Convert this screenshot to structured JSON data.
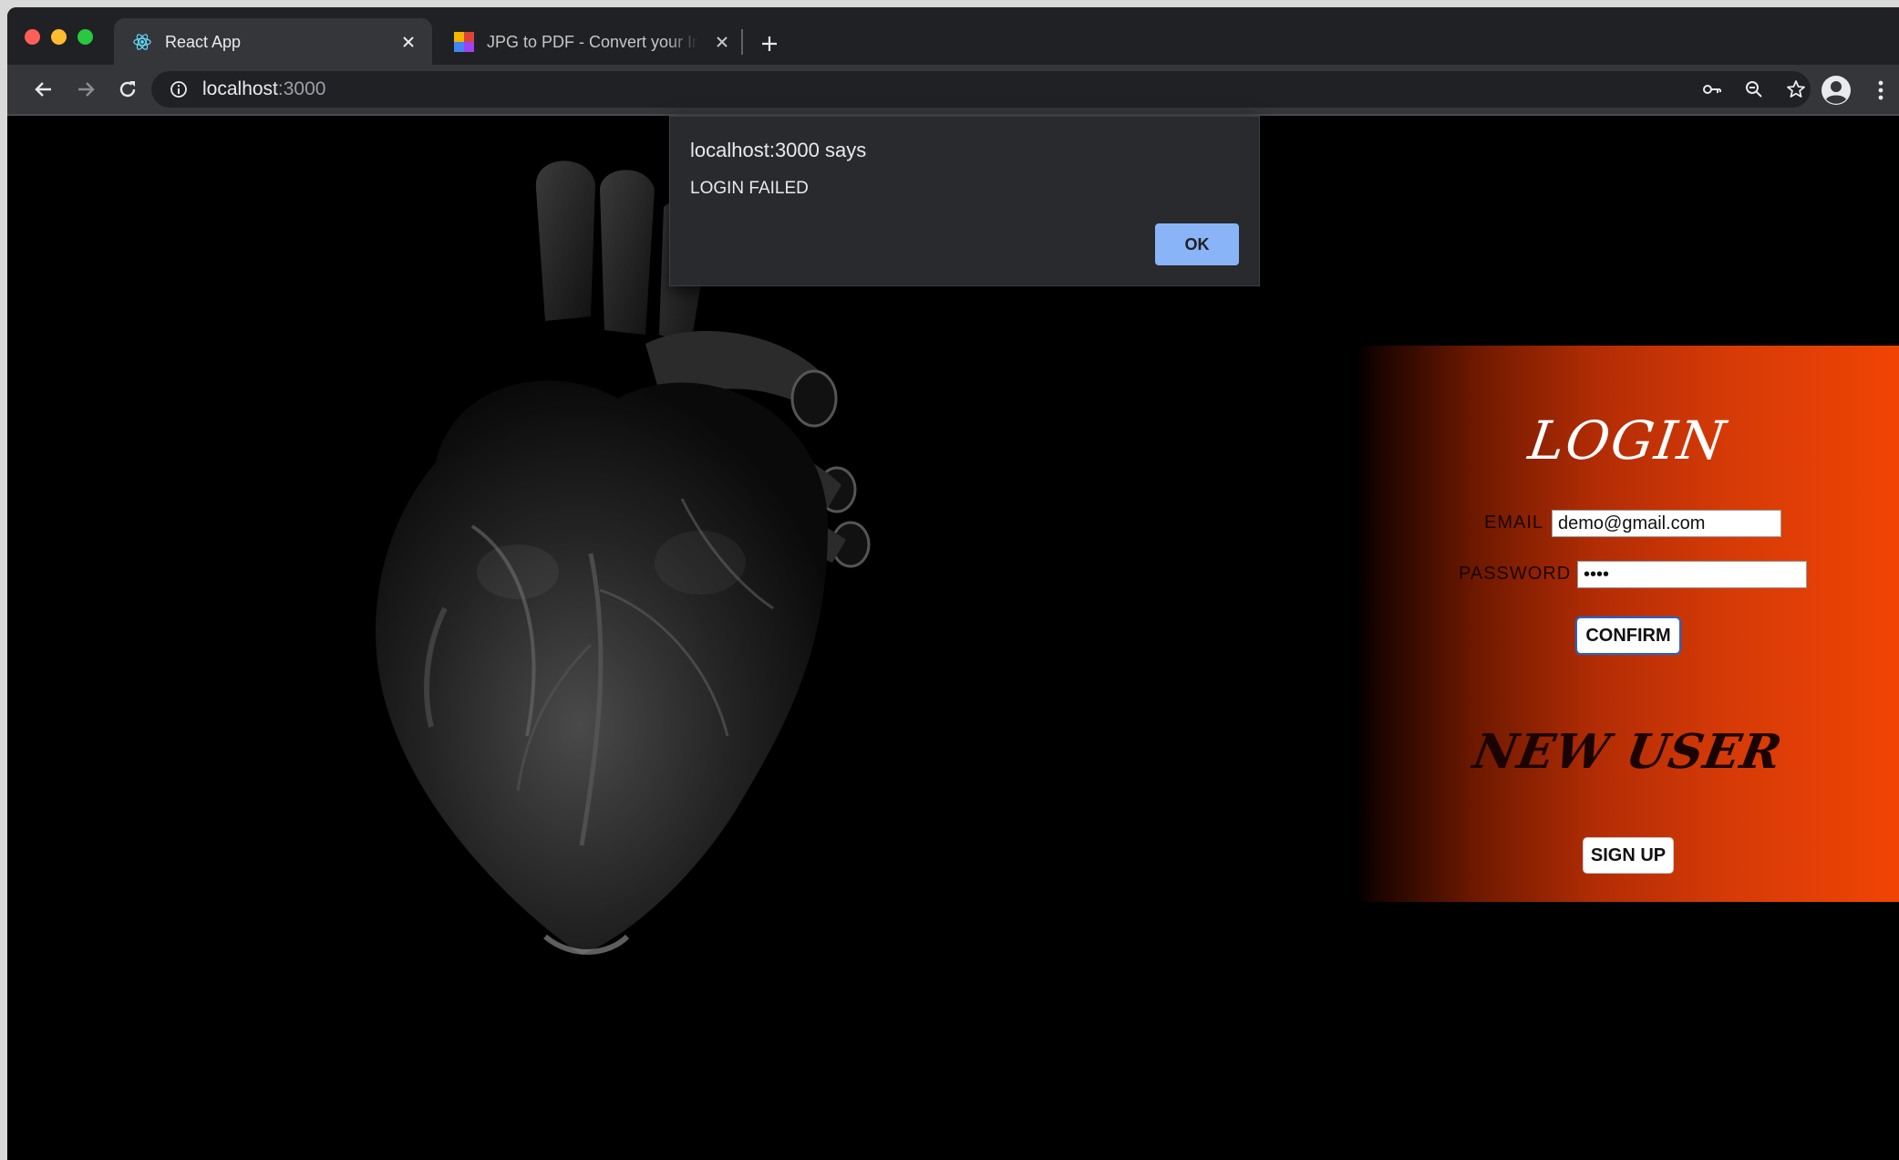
{
  "browser": {
    "tabs": [
      {
        "title": "React App",
        "active": true,
        "favicon": "react-logo-icon"
      },
      {
        "title": "JPG to PDF - Convert your Images",
        "active": false,
        "favicon": "jpg2pdf-logo-icon"
      }
    ],
    "address": {
      "host": "localhost",
      "port": ":3000"
    },
    "icons": [
      "back-arrow-icon",
      "forward-arrow-icon",
      "reload-icon",
      "info-icon",
      "key-icon",
      "zoom-icon",
      "star-icon",
      "profile-icon",
      "menu-icon",
      "close-icon",
      "plus-icon"
    ]
  },
  "dialog": {
    "title": "localhost:3000 says",
    "message": "LOGIN FAILED",
    "ok_label": "OK"
  },
  "login": {
    "title": "LOGIN",
    "email_label": "EMAIL",
    "email_value": "demo@gmail.com",
    "password_label": "PASSWORD",
    "password_value": "••••",
    "confirm_label": "CONFIRM",
    "new_user_title": "NEW USER",
    "signup_label": "SIGN UP"
  },
  "colors": {
    "panel_gradient_end": "#f14404",
    "dialog_bg": "#292a2d",
    "ok_button": "#8ab4f8",
    "focus_ring": "#1a66d9"
  }
}
